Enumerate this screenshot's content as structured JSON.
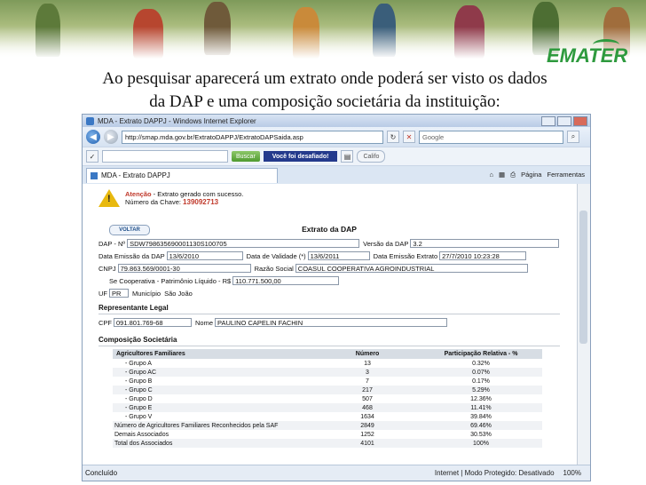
{
  "slide": {
    "logo_text": "EMATER",
    "caption_line1": "Ao pesquisar aparecerá um extrato onde poderá ser visto os dados",
    "caption_line2": "da DAP e uma composição societária da instituição:"
  },
  "browser": {
    "window_title": "MDA - Extrato DAPPJ - Windows Internet Explorer",
    "url": "http://smap.mda.gov.br/ExtratoDAPPJ/ExtratoDAPSaida.asp",
    "search_placeholder": "Google",
    "toolbar_search_label": "Buscar",
    "desafio_label": "Você foi desafiado!",
    "radio_label": "Califo",
    "tab_label": "MDA - Extrato DAPPJ",
    "page_menu": "Página",
    "tools_menu": "Ferramentas",
    "status_left": "Concluído",
    "status_zone": "Internet | Modo Protegido: Desativado",
    "zoom": "100%"
  },
  "page": {
    "alert_title": "Atenção",
    "alert_message": " - Extrato gerado com sucesso.",
    "alert_key_label": "Número da Chave: ",
    "alert_key": "139092713",
    "voltar_label": "VOLTAR",
    "heading": "Extrato da DAP",
    "dap_label": "DAP - Nº",
    "dap_value": "SDW798635690001130S100705",
    "versao_label": "Versão da DAP",
    "versao_value": "3.2",
    "emissao_label": "Data Emissão da DAP",
    "emissao_value": "13/6/2010",
    "validade_label": "Data de Validade (*)",
    "validade_value": "13/6/2011",
    "extrato_label": "Data Emissão Extrato",
    "extrato_value": "27/7/2010 10:23:28",
    "cnpj_label": "CNPJ",
    "cnpj_value": "79.863.569/0001-30",
    "razao_label": "Razão Social",
    "razao_value": "COASUL COOPERATIVA AGROINDUSTRIAL",
    "patrimonio_label": "Se Cooperativa - Patrimônio Líquido - R$",
    "patrimonio_value": "110.771.500,00",
    "uf_label": "UF",
    "uf_value": "PR",
    "municipio_label": "Município",
    "municipio_value": "São João",
    "rep_heading": "Representante Legal",
    "cpf_label": "CPF",
    "cpf_value": "091.801.769-68",
    "nome_label": "Nome",
    "nome_value": "PAULINO CAPELIN FACHIN",
    "comp_heading": "Composição Societária",
    "table_headers": [
      "Agricultores Familiares",
      "Número",
      "Participação Relativa - %"
    ],
    "table_rows": [
      [
        "- Grupo A",
        "13",
        "0.32%"
      ],
      [
        "- Grupo AC",
        "3",
        "0.07%"
      ],
      [
        "- Grupo B",
        "7",
        "0.17%"
      ],
      [
        "- Grupo C",
        "217",
        "5.29%"
      ],
      [
        "- Grupo D",
        "507",
        "12.36%"
      ],
      [
        "- Grupo E",
        "468",
        "11.41%"
      ],
      [
        "- Grupo V",
        "1634",
        "39.84%"
      ],
      [
        "Número de Agricultores Familiares Reconhecidos pela SAF",
        "2849",
        "69.46%"
      ],
      [
        "Demais Associados",
        "1252",
        "30.53%"
      ],
      [
        "Total dos Associados",
        "4101",
        "100%"
      ]
    ]
  }
}
